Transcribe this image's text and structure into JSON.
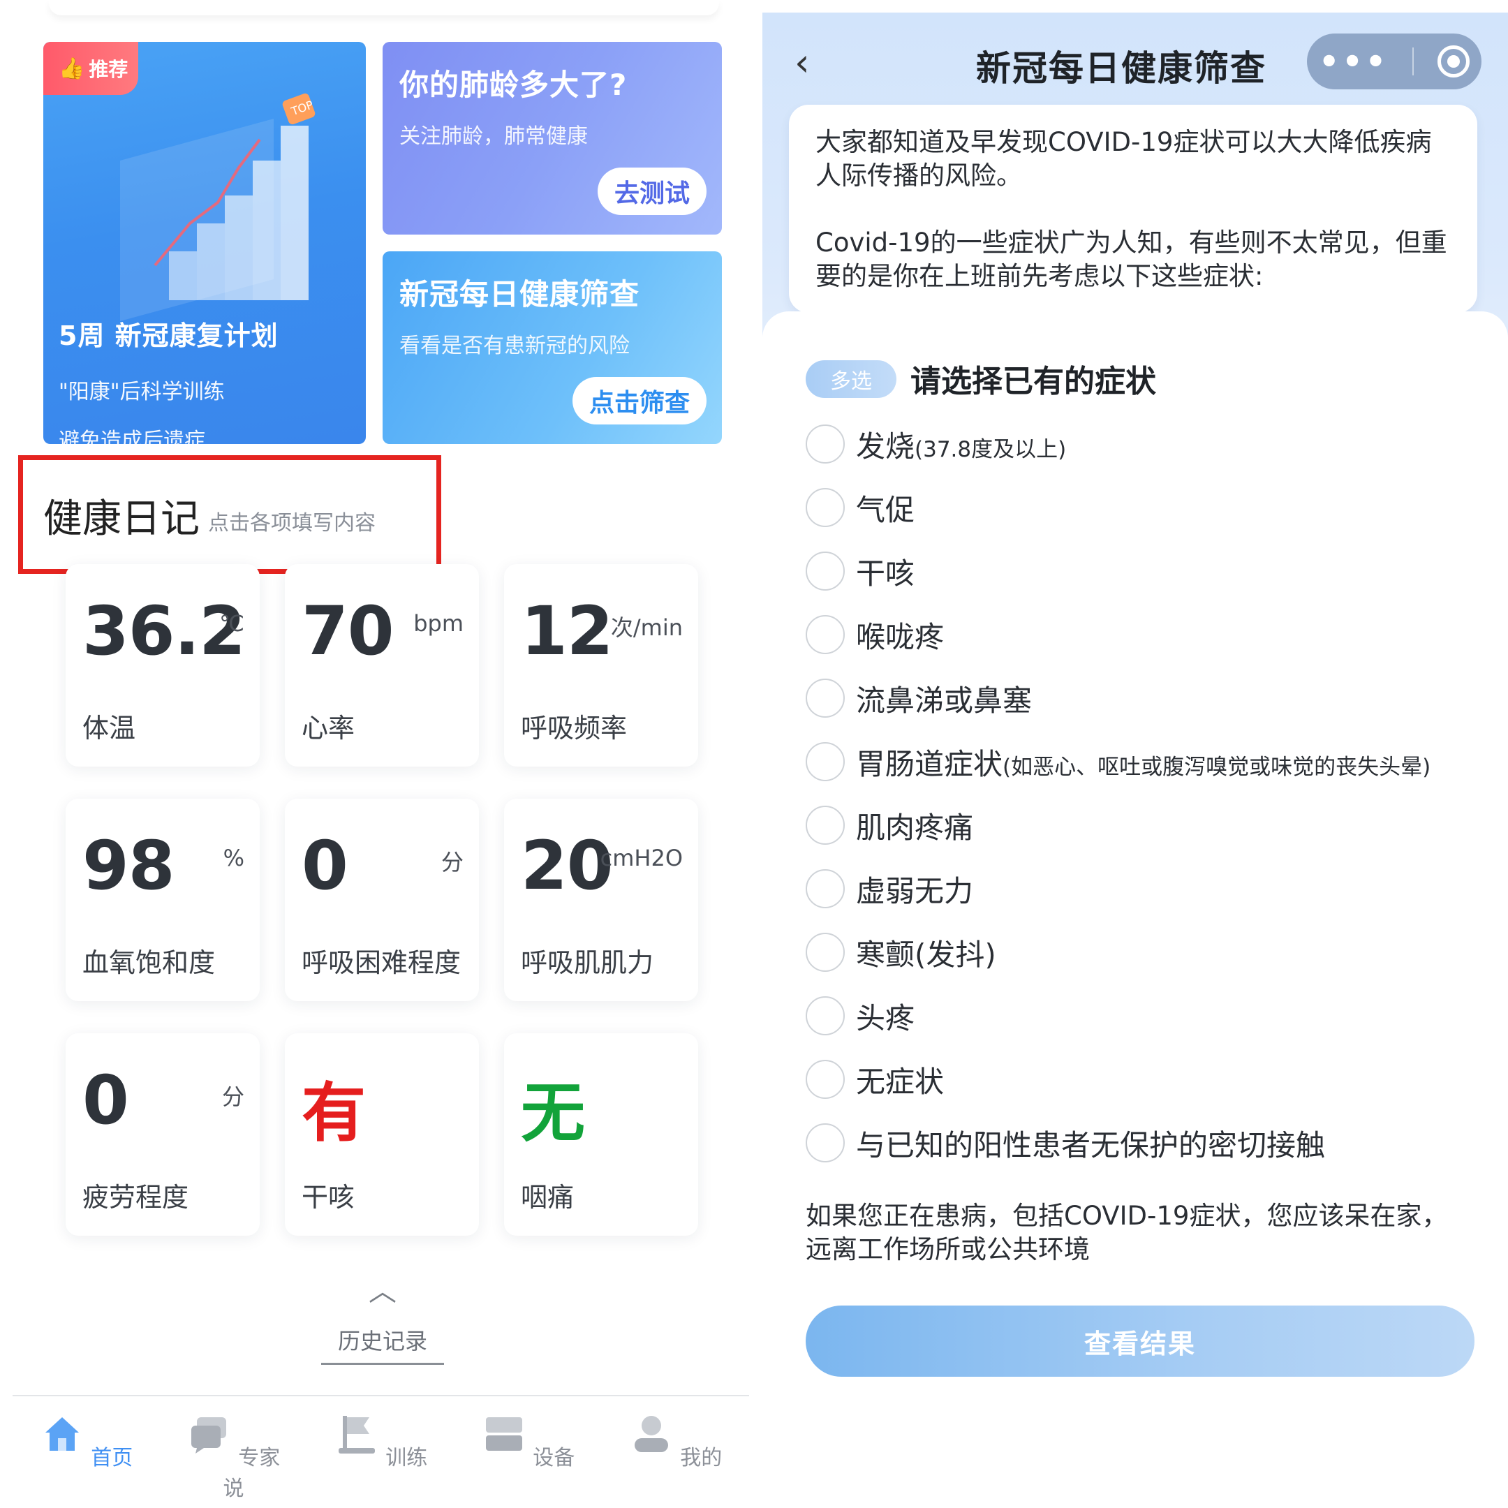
{
  "left": {
    "cards": {
      "plan": {
        "badge": "推荐",
        "title": "5周 新冠康复计划",
        "line1": "\"阳康\"后科学训练",
        "line2": "避免造成后遗症"
      },
      "lung": {
        "title": "你的肺龄多大了?",
        "subtitle": "关注肺龄，肺常健康",
        "button": "去测试"
      },
      "screening": {
        "title": "新冠每日健康筛查",
        "subtitle": "看看是否有患新冠的风险",
        "button": "点击筛查"
      }
    },
    "diary": {
      "title": "健康日记",
      "hint": "点击各项填写内容"
    },
    "metrics": [
      {
        "value": "36.2",
        "unit": "℃",
        "label": "体温"
      },
      {
        "value": "70",
        "unit": "bpm",
        "label": "心率"
      },
      {
        "value": "12",
        "unit": "次/min",
        "label": "呼吸频率"
      },
      {
        "value": "98",
        "unit": "%",
        "label": "血氧饱和度"
      },
      {
        "value": "0",
        "unit": "分",
        "label": "呼吸困难程度"
      },
      {
        "value": "20",
        "unit": "cmH2O",
        "label": "呼吸肌肌力"
      },
      {
        "value": "0",
        "unit": "分",
        "label": "疲劳程度"
      },
      {
        "value": "有",
        "unit": "",
        "label": "干咳"
      },
      {
        "value": "无",
        "unit": "",
        "label": "咽痛"
      }
    ],
    "history": "历史记录",
    "tabs": [
      {
        "label": "首页",
        "icon": "home-icon"
      },
      {
        "label": "专家说",
        "icon": "chat-icon"
      },
      {
        "label": "训练",
        "icon": "flag-icon"
      },
      {
        "label": "设备",
        "icon": "device-icon"
      },
      {
        "label": "我的",
        "icon": "user-icon"
      }
    ],
    "colors": {
      "accent": "#3f8ff3",
      "alert_red": "#e51e1e",
      "ok_green": "#12a33a",
      "highlight_box": "#e52420"
    }
  },
  "right": {
    "title": "新冠每日健康筛查",
    "intro_p1": "大家都知道及早发现COVID-19症状可以大大降低疾病人际传播的风险。",
    "intro_p2": "Covid-19的一些症状广为人知，有些则不太常见，但重要的是你在上班前先考虑以下这些症状:",
    "multi_tag": "多选",
    "question": "请选择已有的症状",
    "options": [
      {
        "main": "发烧",
        "note": "(37.8度及以上)"
      },
      {
        "main": "气促",
        "note": ""
      },
      {
        "main": "干咳",
        "note": ""
      },
      {
        "main": "喉咙疼",
        "note": ""
      },
      {
        "main": "流鼻涕或鼻塞",
        "note": ""
      },
      {
        "main": "胃肠道症状",
        "note": "(如恶心、呕吐或腹泻嗅觉或味觉的丧失头晕)"
      },
      {
        "main": "肌肉疼痛",
        "note": ""
      },
      {
        "main": "虚弱无力",
        "note": ""
      },
      {
        "main": "寒颤(发抖)",
        "note": ""
      },
      {
        "main": "头疼",
        "note": ""
      },
      {
        "main": "无症状",
        "note": ""
      },
      {
        "main": "与已知的阳性患者无保护的密切接触",
        "note": ""
      }
    ],
    "advice": "如果您正在患病，包括COVID-19症状，您应该呆在家，远离工作场所或公共环境",
    "result_button": "查看结果"
  }
}
